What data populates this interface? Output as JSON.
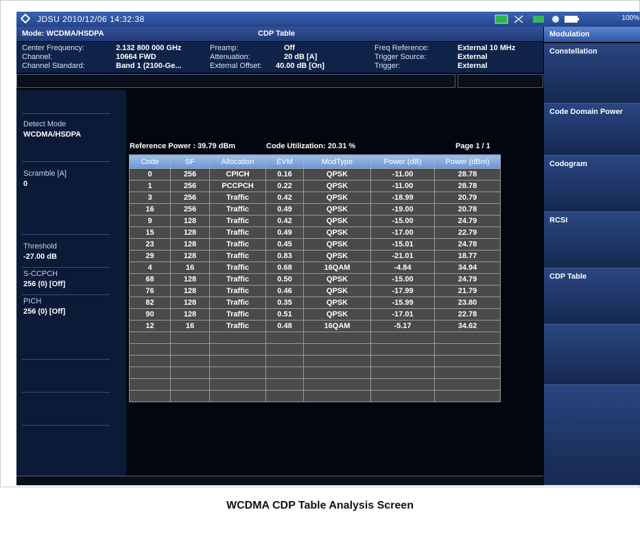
{
  "status_bar": {
    "title": "JDSU  2010/12/06 14:32:38",
    "battery_text": "100%"
  },
  "mode_row": {
    "mode": "Mode: WCDMA/HSDPA",
    "screen": "CDP Table"
  },
  "settings": {
    "center_frequency_label": "Center Frequency:",
    "center_frequency_value": "2.132 800 000 GHz",
    "channel_label": "Channel:",
    "channel_value": "10664 FWD",
    "channel_standard_label": "Channel Standard:",
    "channel_standard_value": "Band 1 (2100-Ge...",
    "preamp_label": "Preamp:",
    "preamp_value": "Off",
    "attenuation_label": "Attenuation:",
    "attenuation_value": "20 dB  [A]",
    "external_offset_label": "External Offset:",
    "external_offset_value": "40.00 dB  [On]",
    "freq_reference_label": "Freq Reference:",
    "freq_reference_value": "External 10 MHz",
    "trigger_source_label": "Trigger Source:",
    "trigger_source_value": "External",
    "trigger_label": "Trigger:",
    "trigger_value": "External"
  },
  "left_panel": {
    "detect_mode_label": "Detect Mode",
    "detect_mode_value": "WCDMA/HSDPA",
    "scramble_label": "Scramble [A]",
    "scramble_value": "0",
    "threshold_label": "Threshold",
    "threshold_value": "-27.00 dB",
    "sccpch_label": "S-CCPCH",
    "sccpch_value": "256 (0) [Off]",
    "pich_label": "PICH",
    "pich_value": "256 (0) [Off]"
  },
  "summary": {
    "reference_power": "Reference Power :  39.79 dBm",
    "code_utilization": "Code Utilization:  20.31  %",
    "page": "Page  1 / 1"
  },
  "table": {
    "headers": [
      "Code",
      "SF",
      "Allocation",
      "EVM",
      "ModType",
      "Power (dB)",
      "Power (dBm)"
    ],
    "rows": [
      [
        "0",
        "256",
        "CPICH",
        "0.16",
        "QPSK",
        "-11.00",
        "28.78"
      ],
      [
        "1",
        "256",
        "PCCPCH",
        "0.22",
        "QPSK",
        "-11.00",
        "28.78"
      ],
      [
        "3",
        "256",
        "Traffic",
        "0.42",
        "QPSK",
        "-18.99",
        "20.79"
      ],
      [
        "16",
        "256",
        "Traffic",
        "0.49",
        "QPSK",
        "-19.00",
        "20.78"
      ],
      [
        "9",
        "128",
        "Traffic",
        "0.42",
        "QPSK",
        "-15.00",
        "24.79"
      ],
      [
        "15",
        "128",
        "Traffic",
        "0.49",
        "QPSK",
        "-17.00",
        "22.79"
      ],
      [
        "23",
        "128",
        "Traffic",
        "0.45",
        "QPSK",
        "-15.01",
        "24.78"
      ],
      [
        "29",
        "128",
        "Traffic",
        "0.83",
        "QPSK",
        "-21.01",
        "18.77"
      ],
      [
        "4",
        "16",
        "Traffic",
        "0.68",
        "16QAM",
        "-4.84",
        "34.94"
      ],
      [
        "68",
        "128",
        "Traffic",
        "0.50",
        "QPSK",
        "-15.00",
        "24.79"
      ],
      [
        "76",
        "128",
        "Traffic",
        "0.46",
        "QPSK",
        "-17.99",
        "21.79"
      ],
      [
        "82",
        "128",
        "Traffic",
        "0.35",
        "QPSK",
        "-15.99",
        "23.80"
      ],
      [
        "90",
        "128",
        "Traffic",
        "0.51",
        "QPSK",
        "-17.01",
        "22.78"
      ],
      [
        "12",
        "16",
        "Traffic",
        "0.48",
        "16QAM",
        "-5.17",
        "34.62"
      ],
      [
        "",
        "",
        "",
        "",
        "",
        "",
        ""
      ],
      [
        "",
        "",
        "",
        "",
        "",
        "",
        ""
      ],
      [
        "",
        "",
        "",
        "",
        "",
        "",
        ""
      ],
      [
        "",
        "",
        "",
        "",
        "",
        "",
        ""
      ],
      [
        "",
        "",
        "",
        "",
        "",
        "",
        ""
      ],
      [
        "",
        "",
        "",
        "",
        "",
        "",
        ""
      ]
    ]
  },
  "softkeys": {
    "header": "Modulation",
    "items": [
      "Constellation",
      "Code Domain Power",
      "Codogram",
      "RCSI",
      "CDP Table",
      "",
      ""
    ]
  },
  "caption": "WCDMA CDP Table Analysis Screen",
  "colors": {
    "header_blue": "#2f56a3",
    "table_header": "#7fa6dc",
    "cell_gray": "#4a4a4a",
    "background": "#02070f"
  }
}
